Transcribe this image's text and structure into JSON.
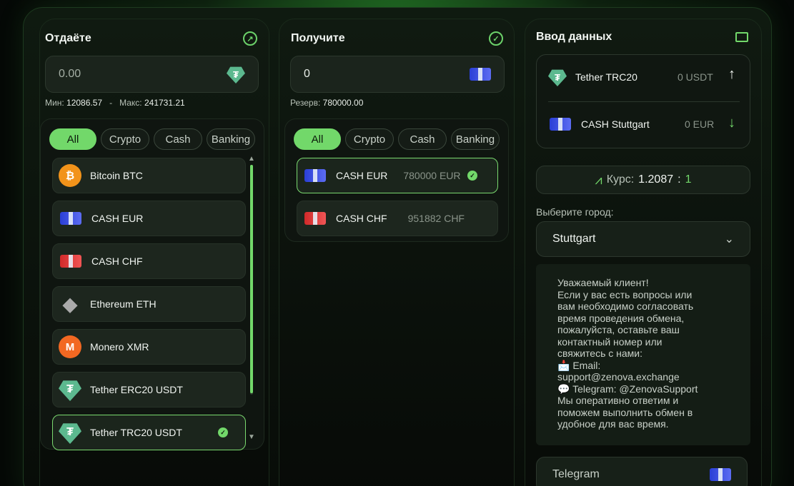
{
  "give": {
    "title": "Отдаёте",
    "amount": "0.00",
    "min_label": "Мин:",
    "min_value": "12086.57",
    "sep": "-",
    "max_label": "Макс:",
    "max_value": "241731.21",
    "filters": [
      "All",
      "Crypto",
      "Cash",
      "Banking"
    ],
    "active_filter": "All",
    "items": [
      {
        "label": "Bitcoin BTC",
        "icon": "bitcoin-icon"
      },
      {
        "label": "CASH EUR",
        "icon": "cash-eur-icon"
      },
      {
        "label": "CASH CHF",
        "icon": "cash-chf-icon"
      },
      {
        "label": "Ethereum ETH",
        "icon": "ethereum-icon"
      },
      {
        "label": "Monero XMR",
        "icon": "monero-icon"
      },
      {
        "label": "Tether ERC20 USDT",
        "icon": "tether-icon"
      },
      {
        "label": "Tether TRC20 USDT",
        "icon": "tether-trc20-icon",
        "selected": true
      }
    ]
  },
  "get": {
    "title": "Получите",
    "amount": "0",
    "reserve_label": "Резерв:",
    "reserve_value": "780000.00",
    "filters": [
      "All",
      "Crypto",
      "Cash",
      "Banking"
    ],
    "active_filter": "All",
    "items": [
      {
        "label": "CASH EUR",
        "amount": "780000 EUR",
        "icon": "cash-eur-icon",
        "selected": true
      },
      {
        "label": "CASH CHF",
        "amount": "951882 CHF",
        "icon": "cash-chf-icon"
      }
    ]
  },
  "data": {
    "title": "Ввод данных",
    "from_label": "Tether TRC20",
    "from_amount": "0 USDT",
    "to_label": "CASH Stuttgart",
    "to_amount": "0 EUR",
    "rate_label": "Курс:",
    "rate_value": "1.2087",
    "rate_sep": ":",
    "rate_target": "1",
    "city_label": "Выберите город:",
    "city_value": "Stuttgart",
    "notice": "Уважаемый клиент!\nЕсли у вас есть вопросы или\nвам необходимо согласовать\nвремя проведения обмена,\nпожалуйста, оставьте ваш\nконтактный номер или\nсвяжитесь с нами:\n📩 Email:\nsupport@zenova.exchange\n💬 Telegram: @ZenovaSupport\nМы оперативно ответим и\nпоможем выполнить обмен в\nудобное для вас время.",
    "telegram_label": "Telegram"
  },
  "colors": {
    "accent": "#72d86a",
    "background": "#050806"
  }
}
